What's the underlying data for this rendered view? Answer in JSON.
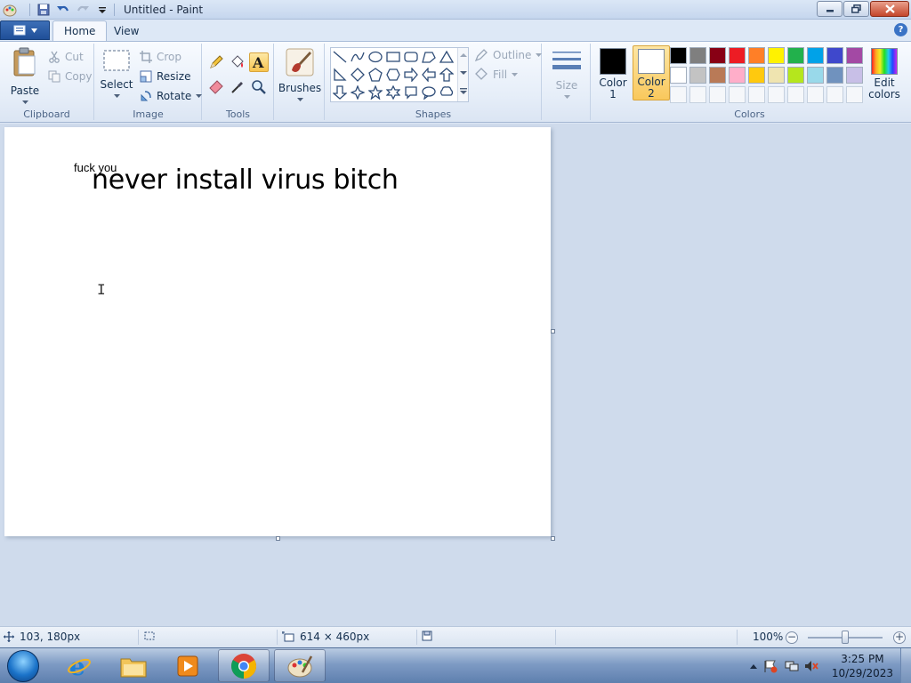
{
  "window": {
    "title": "Untitled - Paint"
  },
  "tabs": [
    {
      "label": "Home"
    },
    {
      "label": "View"
    }
  ],
  "ribbon": {
    "clipboard": {
      "group_label": "Clipboard",
      "paste": "Paste",
      "cut": "Cut",
      "copy": "Copy"
    },
    "image": {
      "group_label": "Image",
      "select": "Select",
      "crop": "Crop",
      "resize": "Resize",
      "rotate": "Rotate"
    },
    "tools": {
      "group_label": "Tools"
    },
    "brushes": {
      "label": "Brushes"
    },
    "shapes": {
      "group_label": "Shapes",
      "outline": "Outline",
      "fill": "Fill"
    },
    "size": {
      "label": "Size"
    },
    "colors": {
      "group_label": "Colors",
      "color1_line1": "Color",
      "color1_line2": "1",
      "color2_line1": "Color",
      "color2_line2": "2",
      "edit_line1": "Edit",
      "edit_line2": "colors",
      "color1_value": "#000000",
      "color2_value": "#ffffff",
      "palette_row1": [
        "#000000",
        "#7f7f7f",
        "#880015",
        "#ed1c24",
        "#ff7f27",
        "#fff200",
        "#22b14c",
        "#00a2e8",
        "#3f48cc",
        "#a349a4"
      ],
      "palette_row2": [
        "#ffffff",
        "#c3c3c3",
        "#b97a57",
        "#ffaec9",
        "#ffc90e",
        "#efe4b0",
        "#b5e61d",
        "#99d9ea",
        "#7092be",
        "#c8bfe7"
      ]
    }
  },
  "canvas": {
    "small_text": "fuck you",
    "big_text": "never install virus bitch"
  },
  "status": {
    "cursor_pos": "103, 180px",
    "canvas_size": "614 × 460px",
    "zoom": "100%"
  },
  "taskbar": {
    "time": "3:25 PM",
    "date": "10/29/2023"
  }
}
